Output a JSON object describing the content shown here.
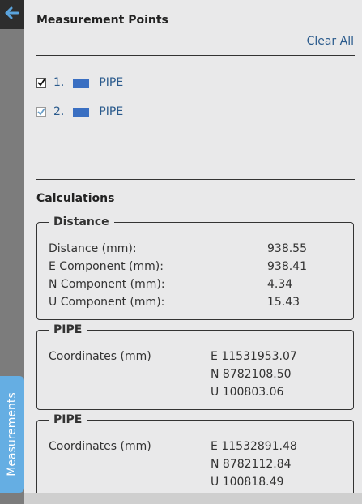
{
  "side": {
    "back_icon": "arrow-left-icon",
    "measurements_tab_label": "Measurements"
  },
  "panel": {
    "title": "Measurement Points",
    "clear_all": "Clear All",
    "points": [
      {
        "index": "1.",
        "name": "PIPE",
        "checked": true,
        "swatch_color": "#3a6fc2"
      },
      {
        "index": "2.",
        "name": "PIPE",
        "checked": true,
        "swatch_color": "#3a6fc2"
      }
    ]
  },
  "calculations": {
    "title": "Calculations",
    "distance": {
      "legend": "Distance",
      "rows": [
        {
          "label": "Distance (mm):",
          "value": "938.55"
        },
        {
          "label": "E Component (mm):",
          "value": "938.41"
        },
        {
          "label": "N Component (mm):",
          "value": "4.34"
        },
        {
          "label": "U Component (mm):",
          "value": "15.43"
        }
      ]
    },
    "points": [
      {
        "legend": "PIPE",
        "label": "Coordinates (mm)",
        "e": "E 11531953.07",
        "n": "N 8782108.50",
        "u": "U 100803.06"
      },
      {
        "legend": "PIPE",
        "label": "Coordinates (mm)",
        "e": "E 11532891.48",
        "n": "N 8782112.84",
        "u": "U 100818.49"
      }
    ]
  },
  "colors": {
    "link": "#2a5a8c",
    "tab": "#65aee3",
    "panel_bg": "#e9e9ea"
  }
}
